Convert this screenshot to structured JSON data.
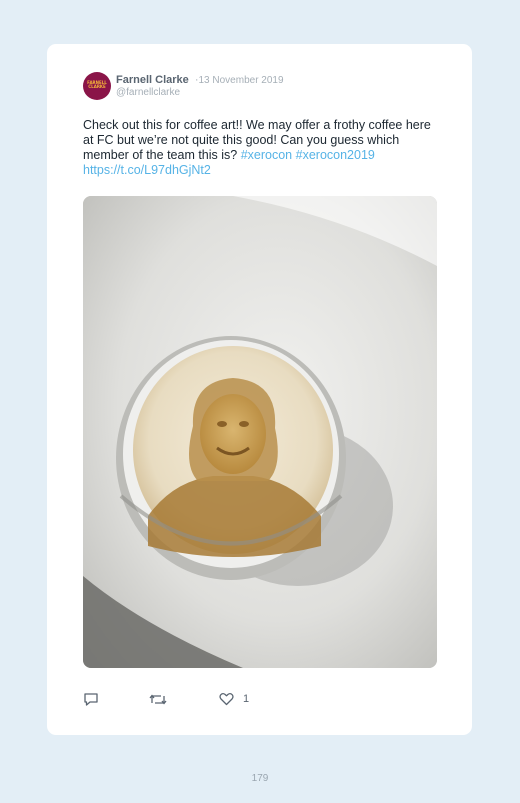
{
  "post": {
    "avatar_text": "FARNELL\nCLARKE",
    "author_name": "Farnell Clarke",
    "separator": "·",
    "date": "13 November 2019",
    "handle": "@farnellclarke",
    "text_before_tags": "Check out this for coffee art!! We may offer a frothy coffee here at FC but we’re not quite this good! Can you guess which member of the team this is? ",
    "hashtag_1": "#xerocon",
    "hashtag_2": "#xerocon2019",
    "link": "https://t.co/L97dhGjNt2",
    "like_count": "1"
  },
  "page": {
    "number": "179"
  },
  "icons": {
    "reply": "reply-icon",
    "retweet": "retweet-icon",
    "like": "heart-icon"
  },
  "colors": {
    "background": "#e3eef6",
    "link": "#56b3e6",
    "avatar": "#8a1548"
  }
}
